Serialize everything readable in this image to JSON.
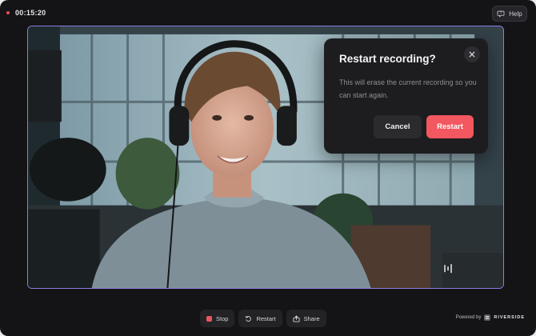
{
  "recording": {
    "elapsed": "00:15:20"
  },
  "header": {
    "help_label": "Help"
  },
  "modal": {
    "title": "Restart recording?",
    "body": "This will erase the current recording so you can start again.",
    "cancel_label": "Cancel",
    "confirm_label": "Restart"
  },
  "toolbar": {
    "stop_label": "Stop",
    "restart_label": "Restart",
    "share_label": "Share"
  },
  "footer": {
    "powered_by": "Powered by",
    "brand": "RIVERSIDE"
  },
  "colors": {
    "accent_border": "#8b7ee3",
    "danger": "#f3575f",
    "record_dot": "#ea4d55"
  }
}
